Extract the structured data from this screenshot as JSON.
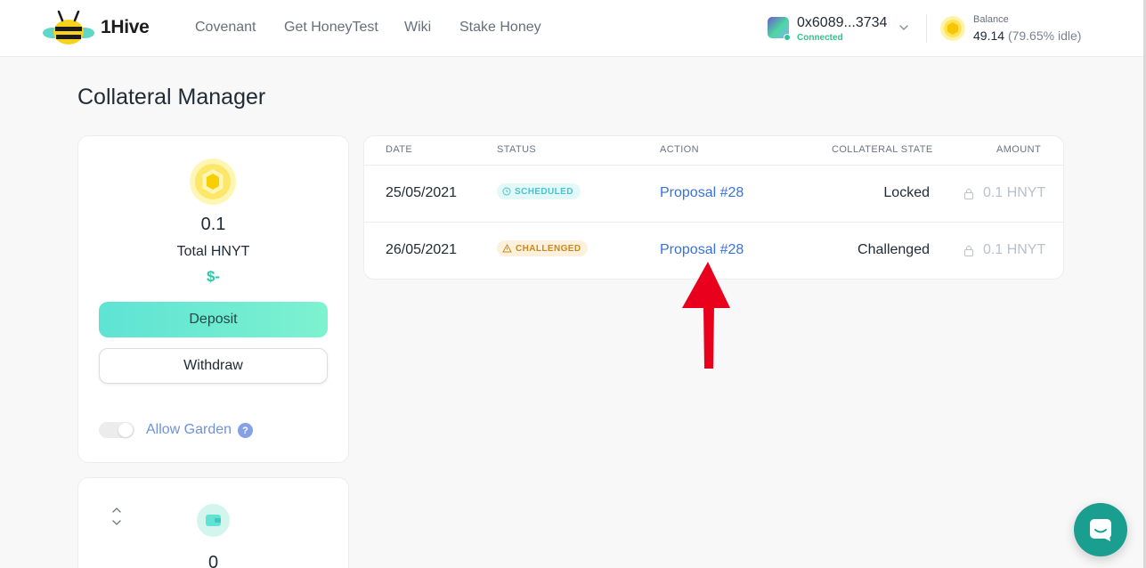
{
  "header": {
    "brand": "1Hive",
    "nav": [
      "Covenant",
      "Get HoneyTest",
      "Wiki",
      "Stake Honey"
    ],
    "account": {
      "address": "0x6089...3734",
      "status": "Connected"
    },
    "balance": {
      "label": "Balance",
      "value": "49.14",
      "idle": "(79.65% idle)"
    }
  },
  "page": {
    "title": "Collateral Manager"
  },
  "summary": {
    "amount": "0.1",
    "amount_label": "Total HNYT",
    "usd": "$-",
    "deposit_label": "Deposit",
    "withdraw_label": "Withdraw",
    "allow_label": "Allow Garden",
    "help_glyph": "?"
  },
  "second_card": {
    "amount": "0"
  },
  "table": {
    "headers": {
      "date": "DATE",
      "status": "STATUS",
      "action": "ACTION",
      "state": "COLLATERAL STATE",
      "amount": "AMOUNT"
    },
    "rows": [
      {
        "date": "25/05/2021",
        "status": "SCHEDULED",
        "action": "Proposal #28",
        "state": "Locked",
        "amount": "0.1 HNYT"
      },
      {
        "date": "26/05/2021",
        "status": "CHALLENGED",
        "action": "Proposal #28",
        "state": "Challenged",
        "amount": "0.1 HNYT"
      }
    ]
  },
  "colors": {
    "accent": "#5ee3d4",
    "link": "#3871df",
    "arrow": "#e8001c",
    "chat": "#1a9e8f"
  },
  "icons": [
    "bee-logo",
    "identicon",
    "chevron-down-icon",
    "honey-coin-icon",
    "question-icon",
    "sort-icon",
    "wallet-icon",
    "clock-icon",
    "warning-icon",
    "lock-icon",
    "annotation-arrow",
    "chat-icon"
  ]
}
